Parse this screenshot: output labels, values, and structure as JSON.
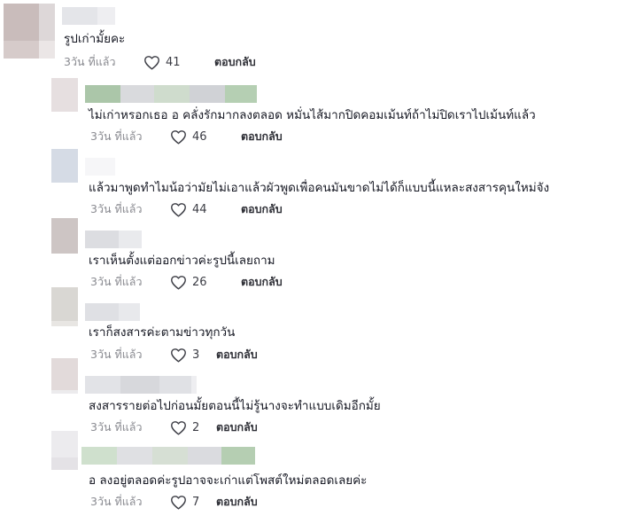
{
  "comments": [
    {
      "text": "รูปเก่ามั้ยคะ",
      "time": "3วัน ที่แล้ว",
      "likes": "41",
      "reply": "ตอบกลับ"
    },
    {
      "text": "ไม่เก่าหรอกเธอ อ คลั่งรักมากลงตลอด หมั่นไส้มากปิดคอมเม้นท์ถ้าไม่ปิดเราไปเม้นท์แล้ว",
      "time": "3วัน ที่แล้ว",
      "likes": "46",
      "reply": "ตอบกลับ"
    },
    {
      "text": "แล้วมาพูดทำไมน้อว่ามัยไม่เอาแล้วผัวพูดเพื่อคนมันขาดไม่ได้ก็แบบนี้แหละสงสารคุนใหม่จัง",
      "time": "3วัน ที่แล้ว",
      "likes": "44",
      "reply": "ตอบกลับ"
    },
    {
      "text": "เราเห็นตั้งแต่ออกข่าวค่ะรูปนี้เลยถาม",
      "time": "3วัน ที่แล้ว",
      "likes": "26",
      "reply": "ตอบกลับ"
    },
    {
      "text": "เราก็สงสารค่ะตามข่าวทุกวัน",
      "time": "3วัน ที่แล้ว",
      "likes": "3",
      "reply": "ตอบกลับ"
    },
    {
      "text": "สงสารรายต่อไปก่อนมั้ยตอนนี้ไม่รู้นางจะทำแบบเดิมอีกมั้ย",
      "time": "3วัน ที่แล้ว",
      "likes": "2",
      "reply": "ตอบกลับ"
    },
    {
      "text": "อ ลงอยู่ตลอดค่ะรูปอาจจะเก่าแต่โพสต์ใหม่ตลอดเลยค่ะ",
      "time": "3วัน ที่แล้ว",
      "likes": "7",
      "reply": "ตอบกลับ"
    }
  ],
  "colors": {
    "text": "#161823",
    "secondary": "#8a8b91"
  },
  "icons": {
    "like": "heart-outline-icon"
  }
}
